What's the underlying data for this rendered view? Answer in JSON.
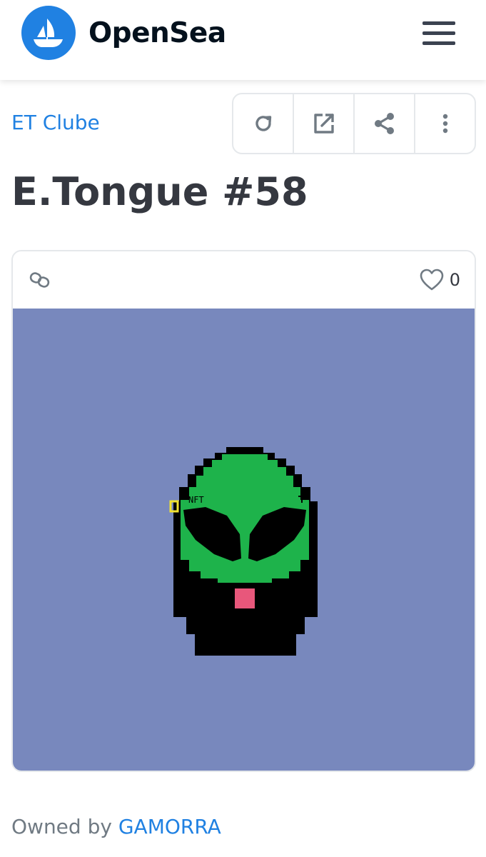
{
  "app": {
    "brand": "OpenSea",
    "logo_icon": "opensea-ship-icon",
    "menu_icon": "hamburger-menu-icon",
    "colors": {
      "brand_blue": "#2081e2",
      "text_dark": "#353840",
      "text_muted": "#707a83",
      "border": "#e5e8eb",
      "artwork_background": "#7888bd"
    }
  },
  "asset": {
    "collection": "ET Clube",
    "title": "E.Tongue #58",
    "favorites": "0",
    "chain_icon": "chain-link-icon",
    "favorite_icon": "heart-outline-icon",
    "owner_prefix": "Owned by",
    "owner_name": "GAMORRA",
    "artwork_text": "NFT"
  },
  "actions": [
    {
      "name": "refresh",
      "icon": "refresh-icon"
    },
    {
      "name": "view-external",
      "icon": "external-link-icon"
    },
    {
      "name": "share",
      "icon": "share-icon"
    },
    {
      "name": "more",
      "icon": "more-vertical-icon"
    }
  ]
}
